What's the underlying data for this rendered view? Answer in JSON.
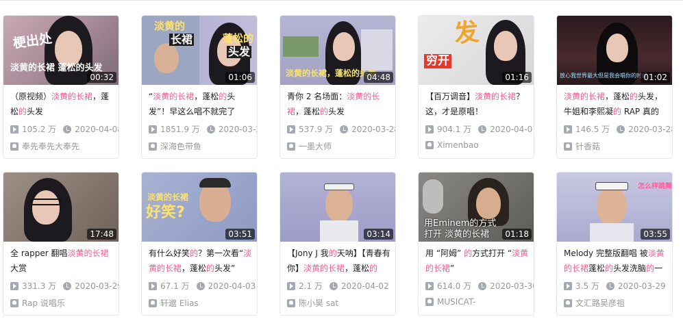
{
  "cards": [
    {
      "duration": "00:32",
      "overlay1": "梗出处",
      "overlay2": "淡黄的长裙 蓬松的头发",
      "title_parts": [
        "（原视频）",
        "淡黄的长裙",
        "，蓬",
        "松",
        "的",
        "头发"
      ],
      "views": "105.2 万",
      "date": "2020-04-08",
      "uploader": "奉先奉先大奉先"
    },
    {
      "duration": "01:06",
      "overlay1": "淡黄的",
      "overlay2": "长裙",
      "overlay3": "蓬松的",
      "overlay4": "头发",
      "title_parts": [
        "“",
        "淡黄的长裙",
        "，蓬松",
        "的",
        "头",
        "发”！早这么唱不就完了"
      ],
      "views": "1851.9 万",
      "date": "2020-03-28",
      "uploader": "深海色带鱼"
    },
    {
      "duration": "04:48",
      "overlay1": "淡黄的长裙，蓬松的头发",
      "title_parts": [
        "青你 2 名场面：",
        "淡黄的长",
        "裙",
        "，蓬松",
        "的",
        "头发"
      ],
      "views": "537.9 万",
      "date": "2020-03-28",
      "uploader": "一墨大师"
    },
    {
      "duration": "01:16",
      "overlay1": "发",
      "overlay2": "穷开",
      "title_parts": [
        "【百万调音】",
        "淡黄的长裙",
        "？这，才是原唱！"
      ],
      "views": "904.1 万",
      "date": "2020-04-01",
      "uploader": "Ximenbao"
    },
    {
      "duration": "01:02",
      "overlay1": "放心我世界最大但是我会唱你的时候",
      "title_parts": [
        "淡黄的长裙",
        "，蓬松",
        "的",
        "头发，牛姐和李熙凝",
        "的",
        " RAP 真的"
      ],
      "views": "146.5 万",
      "date": "2020-03-28",
      "uploader": "针香菇"
    },
    {
      "duration": "17:48",
      "title_parts": [
        "全 rapper 翻唱",
        "淡黄的长裙",
        "大赏"
      ],
      "views": "331.3 万",
      "date": "2020-03-29",
      "uploader": "Rap 说唱乐"
    },
    {
      "duration": "03:51",
      "overlay1": "淡黄的长裙",
      "overlay2": "好笑?",
      "title_parts": [
        "有什么好笑",
        "的",
        "？第一次看“",
        "淡黄的长裙",
        "，蓬松",
        "的",
        "头发”"
      ],
      "views": "67.1 万",
      "date": "2020-04-03",
      "uploader": "轩邈 Elias"
    },
    {
      "duration": "03:14",
      "title_parts": [
        "【Jony J 我",
        "的",
        "天呐】【青春有你】",
        "淡黄的长裙",
        "，蓬松",
        "的"
      ],
      "views": "2.1 万",
      "date": "2020-04-02",
      "uploader": "陈小昊 sat"
    },
    {
      "duration": "01:18",
      "overlay1": "用Eminem的方式",
      "overlay2": "打开 淡黄的长裙",
      "title_parts": [
        "用 “阿姆” ",
        "的",
        "方式打开 “",
        "淡黄的长裙",
        "”"
      ],
      "views": "614.0 万",
      "date": "2020-03-30",
      "uploader": "MUSICAT-"
    },
    {
      "duration": "03:55",
      "overlay1": "怎么样跳舞",
      "title_parts": [
        "Melody 完整版翻唱 被",
        "淡黄的长裙",
        "蓬松",
        "的",
        "头发洗脑",
        "的",
        "一"
      ],
      "views": "3.5 万",
      "date": "2020-03-29",
      "uploader": "文汇路吴彦祖"
    }
  ],
  "colors": {
    "highlight": "#f25d8e",
    "meta_text": "#999999",
    "border": "#e5e9ef"
  },
  "icons": {
    "views": "play-count-icon",
    "date": "clock-icon",
    "uploader": "up-user-icon"
  }
}
